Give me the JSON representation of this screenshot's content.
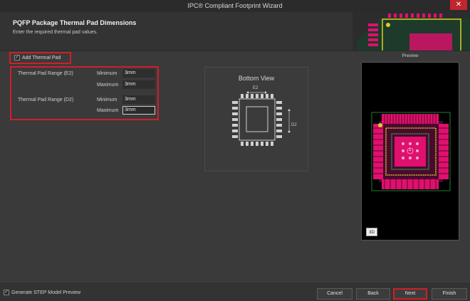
{
  "window": {
    "title": "IPC® Compliant Footprint Wizard",
    "close_glyph": "✕"
  },
  "header": {
    "title": "PQFP Package Thermal Pad Dimensions",
    "subtitle": "Enter the required thermal pad values."
  },
  "thermal": {
    "add_label": "Add Thermal Pad",
    "add_checked": true,
    "e2": {
      "label": "Thermal Pad Range (E2)",
      "min_label": "Minimum",
      "min_value": "3mm",
      "max_label": "Maximum",
      "max_value": "3mm"
    },
    "d2": {
      "label": "Thermal Pad Range (D2)",
      "min_label": "Minimum",
      "min_value": "3mm",
      "max_label": "Maximum",
      "max_value": "3mm"
    }
  },
  "bottom_view": {
    "title": "Bottom View",
    "e2_tag": "E2",
    "d2_tag": "D2"
  },
  "preview": {
    "label": "Preview",
    "btn_3d": "3D",
    "center_tag": "1"
  },
  "footer": {
    "step_label": "Generate STEP Model Preview",
    "step_checked": true,
    "cancel": "Cancel",
    "back": "Back",
    "next": "Next",
    "finish": "Finish"
  },
  "colors": {
    "highlight": "#d01f2b",
    "pad": "#e0106e",
    "outline": "#d8d020",
    "board": "#22a040"
  }
}
